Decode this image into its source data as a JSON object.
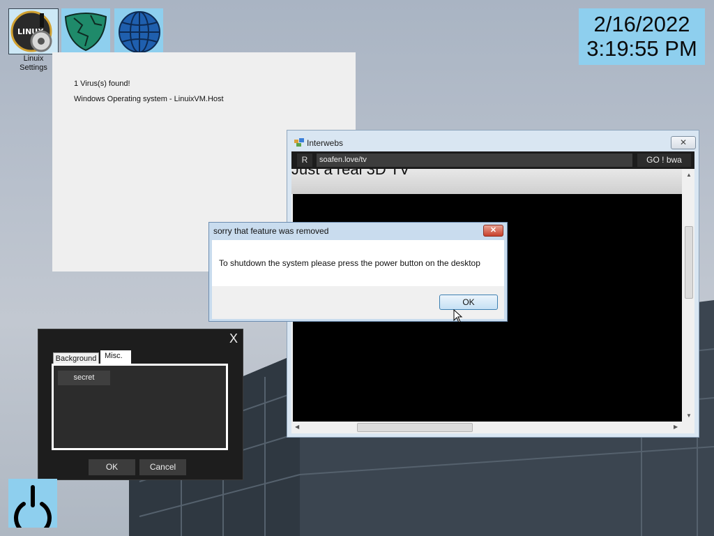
{
  "desktop": {
    "icons": [
      {
        "name": "linux-settings",
        "label_line1": "Linuix",
        "label_line2": "Settings",
        "badge": "LINUX"
      },
      {
        "name": "map-shield"
      },
      {
        "name": "globe"
      }
    ]
  },
  "clock": {
    "date": "2/16/2022",
    "time": "3:19:55 PM"
  },
  "virus_window": {
    "line1": "1 Virus(s) found!",
    "line2": "Windows Operating system - LinuixVM.Host"
  },
  "browser": {
    "title": "Interwebs",
    "close_label": "✕",
    "refresh_label": "R",
    "url": "soafen.love/tv",
    "go_label": "GO ! bwa",
    "page_heading": "Just a real 3D TV"
  },
  "dialog": {
    "title": "sorry that feature was removed",
    "close_label": "✕",
    "message": "To shutdown the system please press the power button on the desktop",
    "ok_label": "OK"
  },
  "settings": {
    "close_label": "X",
    "tabs": [
      "Background",
      "Misc."
    ],
    "active_tab": "Misc.",
    "secret_label": "secret",
    "ok_label": "OK",
    "cancel_label": "Cancel"
  },
  "colors": {
    "icon_bg": "#8ecfee",
    "dialog_frame": "#c9dcee",
    "dark_window": "#1d1d1d"
  }
}
